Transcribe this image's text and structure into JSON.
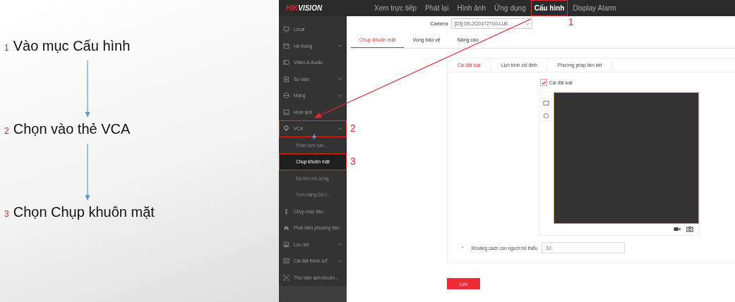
{
  "steps": [
    {
      "number": "1",
      "text": "Vào mục Cấu hình"
    },
    {
      "number": "2",
      "text": "Chọn vào thẻ VCA"
    },
    {
      "number": "3",
      "text": "Chọn Chụp khuôn mặt"
    }
  ],
  "app": {
    "logo_prefix": "HIK",
    "logo_suffix": "VISION",
    "nav": [
      {
        "label": "Xem trực tiếp",
        "selected": false
      },
      {
        "label": "Phát lại",
        "selected": false
      },
      {
        "label": "Hình ảnh",
        "selected": false
      },
      {
        "label": "Ứng dụng",
        "selected": false
      },
      {
        "label": "Cấu hình",
        "selected": true,
        "callout": "1"
      },
      {
        "label": "Display Alarm",
        "selected": false
      }
    ],
    "sidebar": [
      {
        "label": "Local"
      },
      {
        "label": "Hệ thống",
        "expanded": false
      },
      {
        "label": "Video & Audio"
      },
      {
        "label": "Sự kiện",
        "expanded": false
      },
      {
        "label": "Mạng",
        "expanded": false
      },
      {
        "label": "Hình ảnh"
      },
      {
        "label": "VCA",
        "expanded": true,
        "callout": "2",
        "children": [
          {
            "label": "Phân tích hàn...",
            "selected": false
          },
          {
            "label": "Chụp khuôn mặt",
            "selected": true,
            "callout": "3"
          },
          {
            "label": "Dò tìm mũ cứng",
            "selected": false
          },
          {
            "label": "Tính năng Dò t...",
            "selected": false
          }
        ]
      },
      {
        "label": "Chụp mục tiêu"
      },
      {
        "label": "Phát hiện phương tiện"
      },
      {
        "label": "Lưu trữ",
        "expanded": false
      },
      {
        "label": "Cài đặt Kênh IoT",
        "expanded": false
      },
      {
        "label": "Thư viện ảnh khuôn..."
      }
    ],
    "camera": {
      "label": "Camera",
      "value": "[D3] DS-2CD1T27G0-LUE"
    },
    "tabs": [
      {
        "label": "Chụp khuôn mặt",
        "selected": true
      },
      {
        "label": "Vùng bảo vệ",
        "selected": false
      },
      {
        "label": "Nâng cao",
        "selected": false
      }
    ],
    "subtabs": [
      {
        "label": "Cài đặt luật",
        "selected": true
      },
      {
        "label": "Lịch trình chỉ định",
        "selected": false
      },
      {
        "label": "Phương pháp liên kết",
        "selected": false
      }
    ],
    "rule_checkbox": {
      "label": "Cài đặt luật",
      "checked": true
    },
    "min_distance": {
      "label": "Khoảng cách con người tối thiểu",
      "required_mark": "*",
      "value": "63"
    },
    "save_button": "Lưu"
  }
}
